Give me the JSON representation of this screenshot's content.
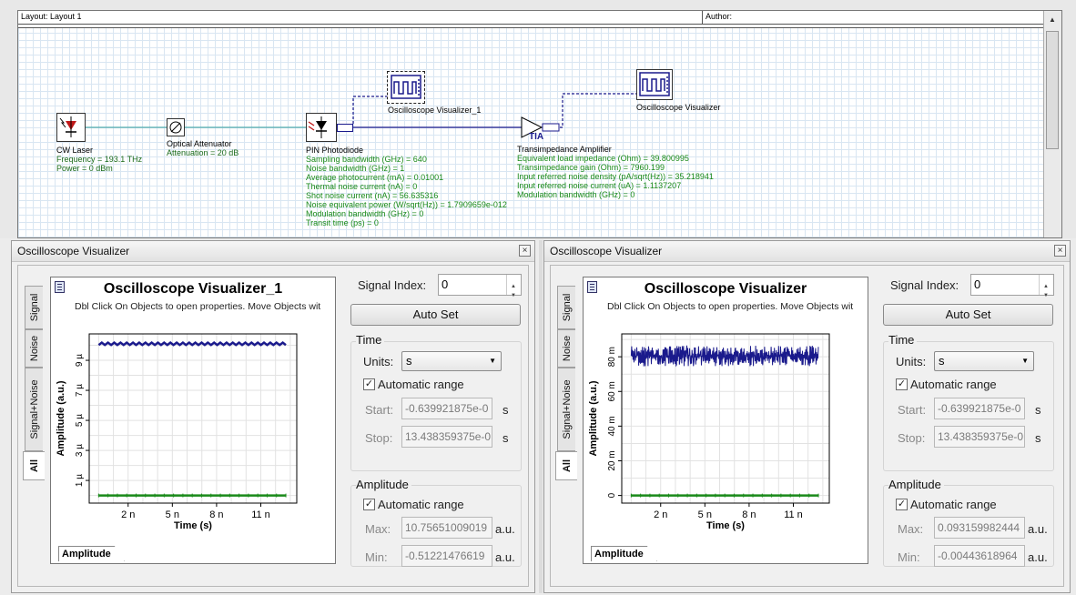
{
  "layout": {
    "title": "Layout: Layout 1",
    "author": "Author:",
    "components": {
      "laser": {
        "name": "CW Laser",
        "params": [
          "Frequency = 193.1  THz",
          "Power = 0  dBm"
        ]
      },
      "attenuator": {
        "name": "Optical Attenuator",
        "params": [
          "Attenuation = 20  dB"
        ]
      },
      "photodiode": {
        "name": "PIN Photodiode",
        "params": [
          "Sampling bandwidth (GHz) = 640",
          "Noise bandwidth (GHz) = 1",
          "Average photocurrent (mA) = 0.01001",
          "Thermal noise current (nA) = 0",
          "Shot noise current (nA) = 56.635316",
          "Noise equivalent power (W/sqrt(Hz)) = 1.7909659e-012",
          "Modulation bandwidth (GHz) = 0",
          "Transit time (ps) = 0"
        ]
      },
      "tia": {
        "name": "Transimpedance Amplifier",
        "symbol": "TIA",
        "params": [
          "Equivalent load impedance (Ohm) = 39.800995",
          "Transimpedance gain (Ohm) = 7960.199",
          "Input referred noise density (pA/sqrt(Hz)) = 35.218941",
          "Input referred noise current (uA) = 1.1137207",
          "Modulation bandwidth (GHz) = 0"
        ]
      },
      "osc1": {
        "name": "Oscilloscope Visualizer_1"
      },
      "osc2": {
        "name": "Oscilloscope Visualizer"
      }
    }
  },
  "panels": [
    {
      "window_title": "Oscilloscope Visualizer",
      "tabs": [
        "Signal",
        "Noise",
        "Signal+Noise",
        "All"
      ],
      "plot_title": "Oscilloscope Visualizer_1",
      "hint": "Dbl Click On Objects to open properties.  Move Objects wit",
      "bottom_tab": "Amplitude",
      "signal_index_label": "Signal Index:",
      "signal_index": "0",
      "autoset": "Auto Set",
      "time_group": "Time",
      "units_label": "Units:",
      "units": "s",
      "auto_range": "Automatic range",
      "start_label": "Start:",
      "start": "-0.639921875e-0",
      "stop_label": "Stop:",
      "stop": "13.438359375e-0",
      "s1": "s",
      "s2": "s",
      "amp_group": "Amplitude",
      "amp_auto": "Automatic range",
      "max_label": "Max:",
      "max": "10.75651009019",
      "min_label": "Min:",
      "min": "-0.51221476619",
      "au1": "a.u.",
      "au2": "a.u."
    },
    {
      "window_title": "Oscilloscope Visualizer",
      "tabs": [
        "Signal",
        "Noise",
        "Signal+Noise",
        "All"
      ],
      "plot_title": "Oscilloscope Visualizer",
      "hint": "Dbl Click On Objects to open properties.  Move Objects wit",
      "bottom_tab": "Amplitude",
      "signal_index_label": "Signal Index:",
      "signal_index": "0",
      "autoset": "Auto Set",
      "time_group": "Time",
      "units_label": "Units:",
      "units": "s",
      "auto_range": "Automatic range",
      "start_label": "Start:",
      "start": "-0.639921875e-0",
      "stop_label": "Stop:",
      "stop": "13.438359375e-0",
      "s1": "s",
      "s2": "s",
      "amp_group": "Amplitude",
      "amp_auto": "Automatic range",
      "max_label": "Max:",
      "max": "0.093159982444",
      "min_label": "Min:",
      "min": "-0.00443618964",
      "au1": "a.u.",
      "au2": "a.u."
    }
  ],
  "chart_data": [
    {
      "type": "line",
      "title": "Oscilloscope Visualizer_1",
      "xlabel": "Time (s)",
      "ylabel": "Amplitude (a.u.)",
      "xticks": [
        "2 n",
        "5 n",
        "8 n",
        "11 n"
      ],
      "xtick_values": [
        2,
        5,
        8,
        11
      ],
      "yticks": [
        "1 µ",
        "3 µ",
        "5 µ",
        "7 µ",
        "9 µ"
      ],
      "ytick_values": [
        1,
        3,
        5,
        7,
        9
      ],
      "xlim": [
        -0.64,
        13.44
      ],
      "ylim": [
        -0.51,
        10.76
      ],
      "series": [
        {
          "values": [
            10.1,
            10.1
          ],
          "color": "#1a1a8c"
        },
        {
          "values": [
            0,
            0
          ],
          "color": "#1a8a1a"
        }
      ]
    },
    {
      "type": "line",
      "title": "Oscilloscope Visualizer",
      "xlabel": "Time (s)",
      "ylabel": "Amplitude (a.u.)",
      "xticks": [
        "2 n",
        "5 n",
        "8 n",
        "11 n"
      ],
      "xtick_values": [
        2,
        5,
        8,
        11
      ],
      "yticks": [
        "0",
        "20 m",
        "40 m",
        "60 m",
        "80 m"
      ],
      "ytick_values": [
        0,
        20,
        40,
        60,
        80
      ],
      "xlim": [
        -0.64,
        13.44
      ],
      "ylim": [
        -4.4,
        93.2
      ],
      "series": [
        {
          "values": [
            80.5,
            80.5
          ],
          "noise": 6,
          "color": "#1a1a8c"
        },
        {
          "values": [
            0,
            0
          ],
          "color": "#1a8a1a"
        }
      ]
    }
  ]
}
